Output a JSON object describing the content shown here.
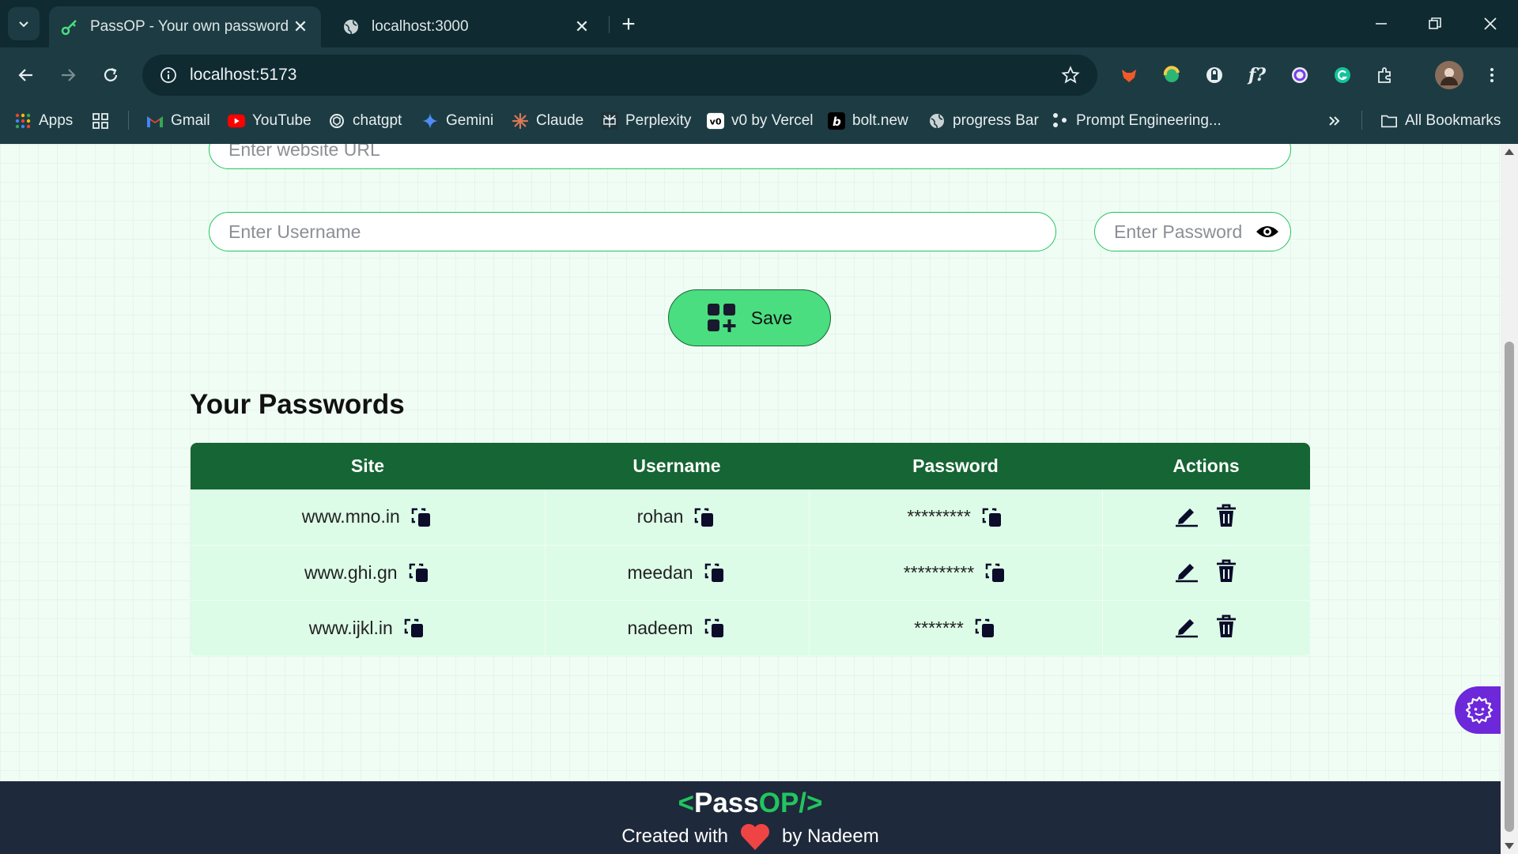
{
  "browser": {
    "tabs": [
      {
        "title": "PassOP - Your own password m",
        "icon": "key-icon",
        "active": true
      },
      {
        "title": "localhost:3000",
        "icon": "globe-icon",
        "active": false
      }
    ],
    "url": "localhost:5173",
    "bookmarks": [
      {
        "label": "Apps",
        "icon": "apps-grid-icon"
      },
      {
        "label": "Gmail",
        "icon": "gmail-icon"
      },
      {
        "label": "YouTube",
        "icon": "youtube-icon"
      },
      {
        "label": "chatgpt",
        "icon": "chatgpt-icon"
      },
      {
        "label": "Gemini",
        "icon": "gemini-icon"
      },
      {
        "label": "Claude",
        "icon": "claude-icon"
      },
      {
        "label": "Perplexity",
        "icon": "perplexity-icon"
      },
      {
        "label": "v0 by Vercel",
        "icon": "v0-icon"
      },
      {
        "label": "bolt.new",
        "icon": "bolt-icon"
      },
      {
        "label": "progress Bar",
        "icon": "globe-icon"
      },
      {
        "label": "Prompt Engineering...",
        "icon": "dots-icon"
      }
    ],
    "all_bookmarks": "All Bookmarks"
  },
  "form": {
    "url_placeholder": "Enter website URL",
    "username_placeholder": "Enter Username",
    "password_placeholder": "Enter Password",
    "save_label": "Save"
  },
  "passwords": {
    "title": "Your Passwords",
    "headers": [
      "Site",
      "Username",
      "Password",
      "Actions"
    ],
    "rows": [
      {
        "site": "www.mno.in",
        "username": "rohan",
        "password": "*********"
      },
      {
        "site": "www.ghi.gn",
        "username": "meedan",
        "password": "**********"
      },
      {
        "site": "www.ijkl.in",
        "username": "nadeem",
        "password": "*******"
      }
    ]
  },
  "footer": {
    "logo_open": "<",
    "logo_pass": "Pass",
    "logo_op": "OP/>",
    "created_with": "Created with",
    "by": "by Nadeem"
  },
  "colors": {
    "accent": "#22c55e",
    "table_header": "#166534",
    "row_bg": "#dcfce7",
    "footer_bg": "#1e293b",
    "heart": "#ef4444"
  }
}
